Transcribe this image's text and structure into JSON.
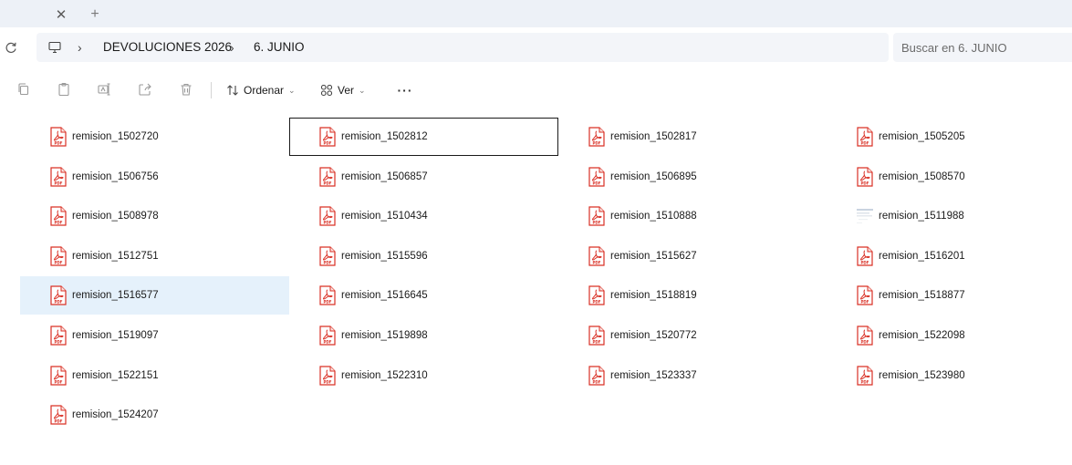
{
  "window": {
    "tab": {
      "close_glyph": "✕",
      "add_glyph": "+"
    }
  },
  "address": {
    "separator": "›",
    "breadcrumb": [
      "DEVOLUCIONES 2026",
      "6. JUNIO"
    ]
  },
  "search": {
    "placeholder": "Buscar en 6. JUNIO"
  },
  "toolbar": {
    "sort_label": "Ordenar",
    "view_label": "Ver",
    "more_label": "···",
    "icons": [
      "copy-icon",
      "paste-icon",
      "rename-icon",
      "share-icon",
      "delete-icon"
    ]
  },
  "files": {
    "columns": [
      [
        "remision_1502720",
        "remision_1506756",
        "remision_1508978",
        "remision_1512751",
        "remision_1516577",
        "remision_1519097",
        "remision_1522151",
        "remision_1524207"
      ],
      [
        "remision_1502812",
        "remision_1506857",
        "remision_1510434",
        "remision_1515596",
        "remision_1516645",
        "remision_1519898",
        "remision_1522310"
      ],
      [
        "remision_1502817",
        "remision_1506895",
        "remision_1510888",
        "remision_1515627",
        "remision_1518819",
        "remision_1520772",
        "remision_1523337"
      ],
      [
        "remision_1505205",
        "remision_1508570",
        "remision_1511988",
        "remision_1516201",
        "remision_1518877",
        "remision_1522098",
        "remision_1523980"
      ]
    ],
    "selected": "remision_1516577",
    "focused": "remision_1502812",
    "image_thumbnail": "remision_1511988",
    "icon": "pdf-icon",
    "colors": {
      "pdf_red": "#d93025",
      "selected_bg": "#e5f1fb",
      "tabbar_bg": "#edf1f7"
    }
  }
}
